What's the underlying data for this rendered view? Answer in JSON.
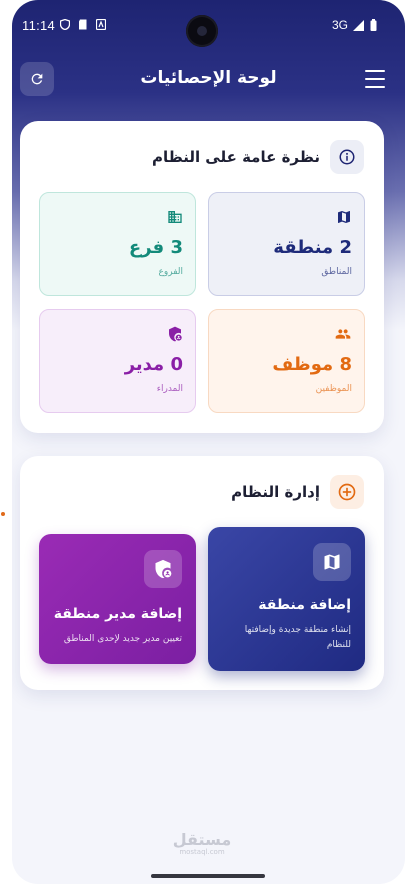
{
  "status_bar": {
    "time": "11:14",
    "network": "3G",
    "icons": [
      "shield-icon",
      "sd-card-icon",
      "app-notification-icon",
      "signal-icon",
      "battery-icon"
    ]
  },
  "header": {
    "title": "لوحة الإحصائيات",
    "refresh_icon": "refresh-icon",
    "menu_icon": "menu-icon"
  },
  "overview": {
    "title": "نظرة عامة على النظام",
    "icon": "info-icon",
    "stats": [
      {
        "key": "regions",
        "value": "2 منطقة",
        "label": "المناطق",
        "icon": "map-icon",
        "color": "#1e2b7a",
        "bg": "#eef0f7",
        "border": "#c9cde6"
      },
      {
        "key": "branches",
        "value": "3 فرع",
        "label": "الفروع",
        "icon": "building-icon",
        "color": "#138a7a",
        "bg": "#eef9f6",
        "border": "#bfe6dc"
      },
      {
        "key": "employees",
        "value": "8 موظف",
        "label": "الموظفين",
        "icon": "people-icon",
        "color": "#e26a12",
        "bg": "#fff4ec",
        "border": "#f8d9c2"
      },
      {
        "key": "managers",
        "value": "0 مدير",
        "label": "المدراء",
        "icon": "admin-shield-icon",
        "color": "#8a1fa6",
        "bg": "#f7eefa",
        "border": "#e6cbef"
      }
    ]
  },
  "management": {
    "title": "إدارة النظام",
    "icon": "add-circle-icon",
    "actions": [
      {
        "key": "add_region",
        "title": "إضافة منطقة",
        "desc": "إنشاء منطقة جديدة وإضافتها للنظام",
        "icon": "map-icon"
      },
      {
        "key": "add_manager",
        "title": "إضافة مدير منطقة",
        "desc": "تعيين مدير جديد لإحدى المناطق",
        "icon": "admin-shield-icon"
      }
    ]
  },
  "watermark": {
    "text": "مستقل",
    "sub": "mostaql.com"
  },
  "colors": {
    "header_dark": "#1e2472",
    "accent_orange": "#e26a12",
    "action_blue": "#2a3590",
    "action_purple": "#8e24aa"
  }
}
